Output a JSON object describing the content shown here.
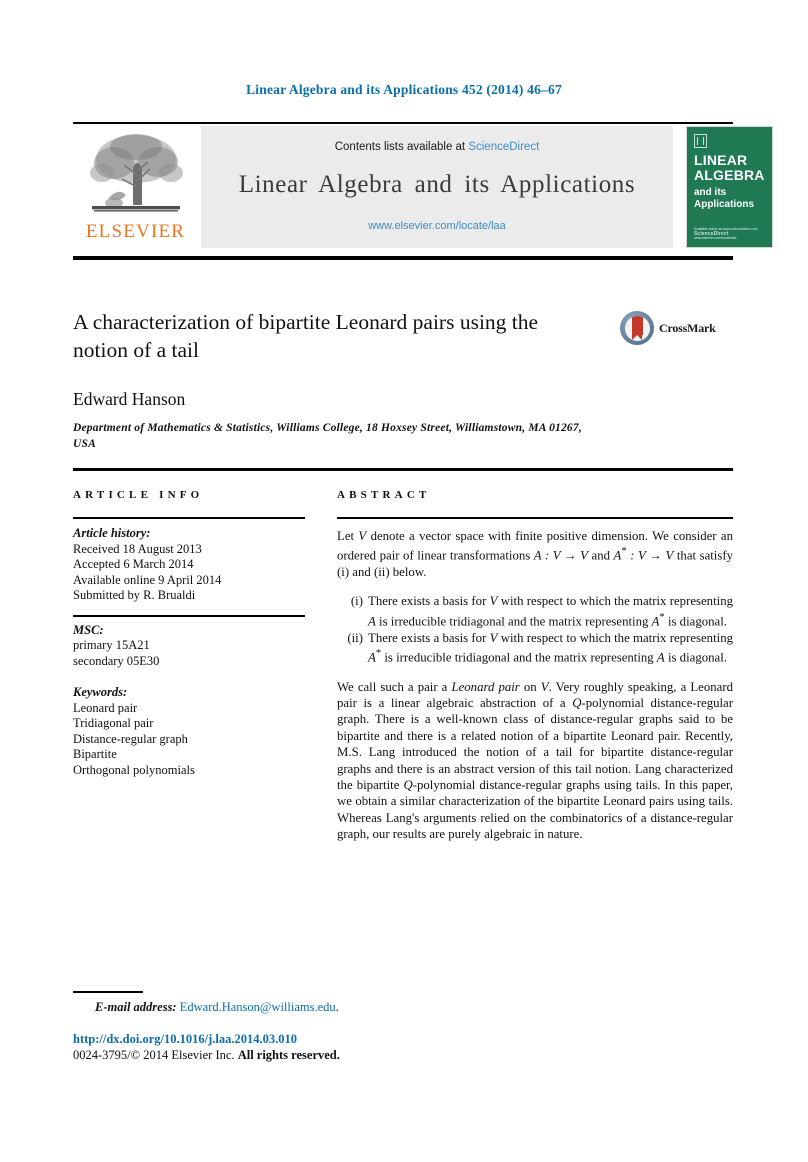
{
  "running_head": "Linear Algebra and its Applications 452 (2014) 46–67",
  "masthead": {
    "contents_prefix": "Contents lists available at",
    "sciencedirect": "ScienceDirect",
    "journal_title": "Linear Algebra and its Applications",
    "journal_url": "www.elsevier.com/locate/laa",
    "publisher_logo_text": "ELSEVIER",
    "cover": {
      "line1": "LINEAR",
      "line2": "ALGEBRA",
      "line3": "and its",
      "line4": "Applications",
      "foot_brand": "ScienceDirect",
      "foot_small": "Available online at www.sciencedirect.com",
      "foot_url": "www.elsevier.com/locate/laa"
    },
    "accent_blue": "#3c8dc5",
    "elsevier_orange": "#e87722",
    "cover_green": "#1f7a54"
  },
  "article": {
    "title": "A characterization of bipartite Leonard pairs using the notion of a tail",
    "crossmark_label": "CrossMark",
    "author": "Edward Hanson",
    "affiliation": "Department of Mathematics & Statistics, Williams College, 18 Hoxsey Street, Williamstown, MA 01267, USA"
  },
  "info": {
    "heading": "ARTICLE INFO",
    "history_label": "Article history:",
    "history": [
      "Received 18 August 2013",
      "Accepted 6 March 2014",
      "Available online 9 April 2014",
      "Submitted by R. Brualdi"
    ],
    "msc_label": "MSC:",
    "msc": [
      "primary 15A21",
      "secondary 05E30"
    ],
    "keywords_label": "Keywords:",
    "keywords": [
      "Leonard pair",
      "Tridiagonal pair",
      "Distance-regular graph",
      "Bipartite",
      "Orthogonal polynomials"
    ]
  },
  "abstract": {
    "heading": "ABSTRACT",
    "para1_a": "Let ",
    "para1_V": "V",
    "para1_b": " denote a vector space with finite positive dimension. We consider an ordered pair of linear transformations ",
    "para1_map1": "A : V → V",
    "para1_c": " and ",
    "para1_map2": "A",
    "para1_map2b": " : V → V",
    "para1_d": " that satisfy (i) and (ii) below.",
    "items": [
      {
        "marker": "(i)",
        "a": "There exists a basis for ",
        "V": "V",
        "b": " with respect to which the matrix representing ",
        "m1": "A",
        "c": " is irreducible tridiagonal and the matrix representing ",
        "m2": "A",
        "d": " is diagonal."
      },
      {
        "marker": "(ii)",
        "a": "There exists a basis for ",
        "V": "V",
        "b": " with respect to which the matrix representing ",
        "m1": "A",
        "c": " is irreducible tridiagonal and the matrix representing ",
        "m2": "A",
        "d": " is diagonal."
      }
    ],
    "para2_a": "We call such a pair a ",
    "para2_em": "Leonard pair",
    "para2_b": " on ",
    "para2_V": "V",
    "para2_c": ". Very roughly speaking, a Leonard pair is a linear algebraic abstraction of a ",
    "para2_Q": "Q",
    "para2_d": "-polynomial distance-regular graph. There is a well-known class of distance-regular graphs said to be bipartite and there is a related notion of a bipartite Leonard pair. Recently, M.S. Lang introduced the notion of a tail for bipartite distance-regular graphs and there is an abstract version of this tail notion. Lang characterized the bipartite ",
    "para2_Q2": "Q",
    "para2_e": "-polynomial distance-regular graphs using tails. In this paper, we obtain a similar characterization of the bipartite Leonard pairs using tails. Whereas Lang's arguments relied on the combinatorics of a distance-regular graph, our results are purely algebraic in nature."
  },
  "footer": {
    "email_label": "E-mail address:",
    "email_address": "Edward.Hanson@williams.edu",
    "email_period": ".",
    "doi": "http://dx.doi.org/10.1016/j.laa.2014.03.010",
    "issn_copyright_prefix": "0024-3795/© 2014 Elsevier Inc. ",
    "copyright_rights": "All rights reserved."
  }
}
